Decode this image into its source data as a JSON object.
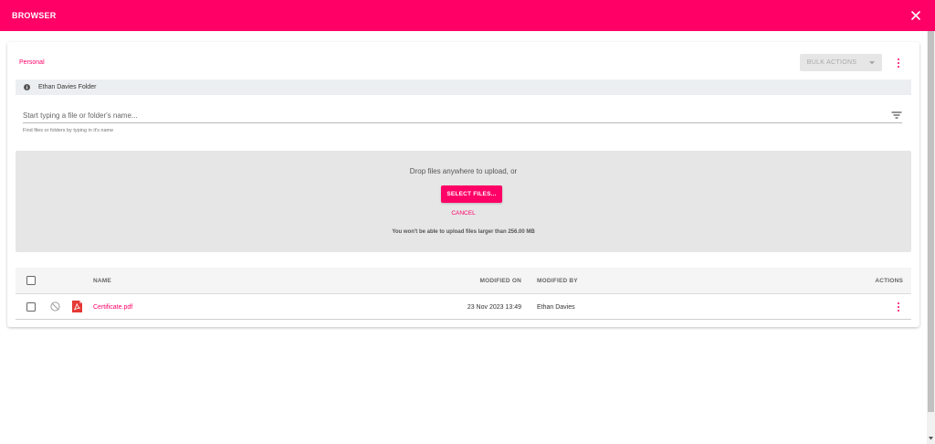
{
  "app": {
    "title": "BROWSER",
    "accent": "#ff0066"
  },
  "toolbar": {
    "breadcrumb": "Personal",
    "bulk_actions_label": "BULK ACTIONS"
  },
  "folder": {
    "name": "Ethan Davies Folder"
  },
  "search": {
    "placeholder": "Start typing a file or folder's name...",
    "value": "",
    "hint": "Find files or folders by typing in it's name"
  },
  "upload": {
    "drop_text": "Drop files anywhere to upload, or",
    "select_label": "SELECT FILES...",
    "cancel_label": "CANCEL",
    "limit_text": "You won't be able to upload files larger than 256.00 MB"
  },
  "table": {
    "columns": {
      "name": "NAME",
      "modified_on": "MODIFIED ON",
      "modified_by": "MODIFIED BY",
      "actions": "ACTIONS"
    },
    "rows": [
      {
        "name": "Certificate.pdf",
        "modified_on": "23 Nov 2023 13:49",
        "modified_by": "Ethan Davies",
        "file_icon": "pdf-icon",
        "status_icon": "ban-icon"
      }
    ]
  }
}
